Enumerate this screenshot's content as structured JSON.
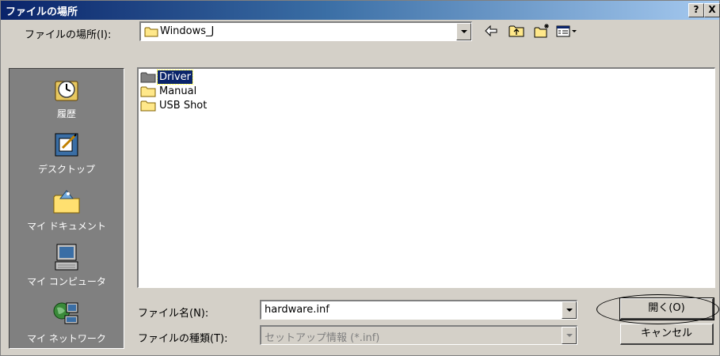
{
  "window": {
    "title": "ファイルの場所",
    "help_label": "?",
    "close_label": "X"
  },
  "lookin": {
    "label": "ファイルの場所(I):",
    "value": "Windows_J"
  },
  "places": [
    {
      "label": "履歴",
      "icon": "history-icon"
    },
    {
      "label": "デスクトップ",
      "icon": "desktop-icon"
    },
    {
      "label": "マイ ドキュメント",
      "icon": "my-documents-icon"
    },
    {
      "label": "マイ コンピュータ",
      "icon": "my-computer-icon"
    },
    {
      "label": "マイ ネットワーク",
      "icon": "my-network-icon"
    }
  ],
  "files": [
    {
      "name": "Driver",
      "selected": true
    },
    {
      "name": "Manual",
      "selected": false
    },
    {
      "name": "USB Shot",
      "selected": false
    }
  ],
  "filename": {
    "label": "ファイル名(N):",
    "value": "hardware.inf"
  },
  "filetype": {
    "label": "ファイルの種類(T):",
    "value": "セットアップ情報 (*.inf)"
  },
  "buttons": {
    "open": "開く(O)",
    "cancel": "キャンセル"
  },
  "colors": {
    "title_gradient_start": "#0a246a",
    "selection": "#0a246a",
    "face": "#d4d0c8",
    "places_bg": "#808080"
  }
}
